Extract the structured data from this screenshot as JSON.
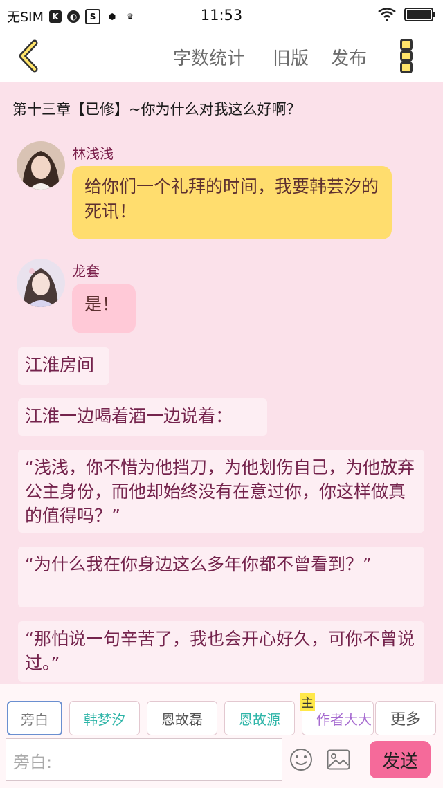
{
  "status_bar": {
    "carrier": "无SIM",
    "time": "11:53"
  },
  "nav": {
    "word_count": "字数统计",
    "old_version": "旧版",
    "publish": "发布"
  },
  "chapter_title": "第十三章【已修】~你为什么对我这么好啊？",
  "messages": [
    {
      "name": "林浅浅",
      "text": "给你们一个礼拜的时间，我要韩芸汐的死讯！"
    },
    {
      "name": "龙套",
      "text": "是！"
    }
  ],
  "narrations": [
    "江淮房间",
    "江淮一边喝着酒一边说着：",
    "“浅浅，你不惜为他挡刀，为他划伤自己，为他放弃公主身份，而他却始终没有在意过你，你这样做真的值得吗？”",
    "“为什么我在你身边这么多年你都不曾看到？”",
    "“那怕说一句辛苦了，我也会开心好久，可你不曾说过。”"
  ],
  "roles": {
    "narrator": "旁白",
    "r1": "韩梦汐",
    "r2": "恩故磊",
    "r3": "恩故源",
    "main_badge": "主",
    "author": "作者大大",
    "more": "更多"
  },
  "composer": {
    "placeholder": "旁白:",
    "send": "发送"
  },
  "colors": {
    "accent_pink": "#f56a9a",
    "bubble_yellow": "#ffdd6e",
    "bubble_pink": "#ffc9d7",
    "narration_text": "#74234c"
  }
}
